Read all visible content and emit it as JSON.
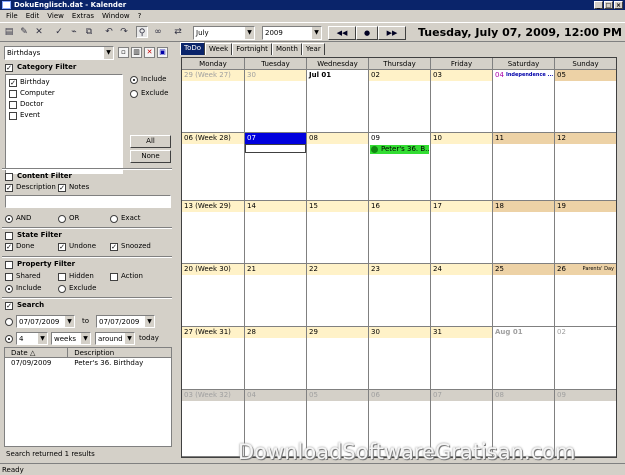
{
  "window": {
    "title": "DokuEnglisch.dat - Kalender",
    "min": "_",
    "max": "□",
    "close": "×"
  },
  "menu": [
    "File",
    "Edit",
    "View",
    "Extras",
    "Window",
    "?"
  ],
  "toolbar": {
    "month": "July",
    "year": "2009",
    "nav": [
      "◀◀",
      "●",
      "▶▶"
    ],
    "date_title": "Tuesday, July 07, 2009, 12:00 PM"
  },
  "left": {
    "profile": "Birthdays",
    "category_filter": {
      "label": "Category Filter",
      "items": [
        {
          "label": "Birthday",
          "checked": true
        },
        {
          "label": "Computer",
          "checked": false
        },
        {
          "label": "Doctor",
          "checked": false
        },
        {
          "label": "Event",
          "checked": false
        }
      ],
      "include": "Include",
      "exclude": "Exclude",
      "all": "All",
      "none": "None"
    },
    "content_filter": {
      "label": "Content Filter",
      "description": "Description",
      "notes": "Notes",
      "and": "AND",
      "or": "OR",
      "exact": "Exact"
    },
    "state_filter": {
      "label": "State Filter",
      "done": "Done",
      "undone": "Undone",
      "snoozed": "Snoozed"
    },
    "property_filter": {
      "label": "Property Filter",
      "shared": "Shared",
      "hidden": "Hidden",
      "action": "Action",
      "include": "Include",
      "exclude": "Exclude"
    },
    "search": {
      "label": "Search",
      "from": "07/07/2009",
      "to_label": "to",
      "to": "07/07/2009",
      "count": "4",
      "unit": "weeks",
      "around": "around",
      "today": "today"
    },
    "results": {
      "col_date": "Date",
      "col_desc": "Description",
      "rows": [
        {
          "date": "07/09/2009",
          "desc": "Peter's 36. Birthday"
        }
      ]
    },
    "status": "Search returned 1 results"
  },
  "tabs": [
    "ToDo",
    "Week",
    "Fortnight",
    "Month",
    "Year"
  ],
  "calendar": {
    "days": [
      "Monday",
      "Tuesday",
      "Wednesday",
      "Thursday",
      "Friday",
      "Saturday",
      "Sunday"
    ],
    "weeks": [
      [
        "29 (Week 27)",
        "30",
        "Jul 01",
        "02",
        "03",
        "04",
        "05"
      ],
      [
        "06 (Week 28)",
        "07",
        "08",
        "09",
        "10",
        "11",
        "12"
      ],
      [
        "13 (Week 29)",
        "14",
        "15",
        "16",
        "17",
        "18",
        "19"
      ],
      [
        "20 (Week 30)",
        "21",
        "22",
        "23",
        "24",
        "25",
        "26"
      ],
      [
        "27 (Week 31)",
        "28",
        "29",
        "30",
        "31",
        "Aug 01",
        "02"
      ],
      [
        "03 (Week 32)",
        "04",
        "05",
        "06",
        "07",
        "08",
        "09"
      ]
    ],
    "holiday_jul4": "Independence ...",
    "parents_day": "Parents' Day",
    "event_jul9": "Peter's 36. B..."
  },
  "watermark": "DownloadSoftwareGratisan.com",
  "statusbar": "Ready",
  "colors": {
    "accent": "#0a246a",
    "today": "#0000dd",
    "weekday": "#fff2c8",
    "weekend": "#edd2a6",
    "event": "#33dd33"
  }
}
